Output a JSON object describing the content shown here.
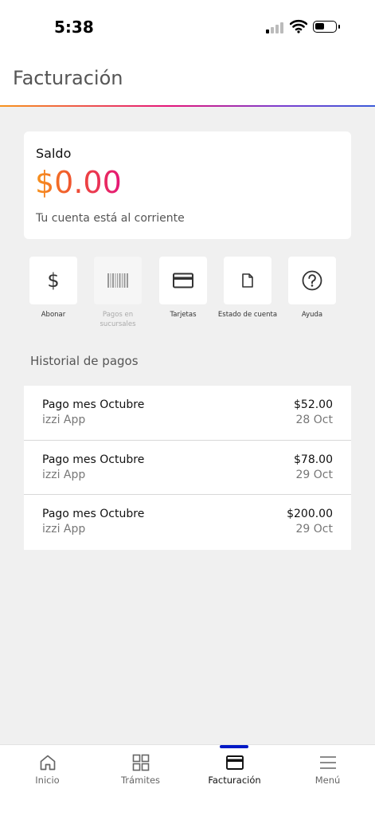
{
  "status_bar": {
    "time": "5:38"
  },
  "header": {
    "title": "Facturación"
  },
  "balance": {
    "label": "Saldo",
    "amount": "$0.00",
    "status": "Tu cuenta está al corriente"
  },
  "actions": [
    {
      "label": "Abonar",
      "icon": "dollar-icon",
      "enabled": true
    },
    {
      "label": "Pagos en sucursales",
      "icon": "barcode-icon",
      "enabled": false
    },
    {
      "label": "Tarjetas",
      "icon": "credit-card-icon",
      "enabled": true
    },
    {
      "label": "Estado de cuenta",
      "icon": "document-icon",
      "enabled": true
    },
    {
      "label": "Ayuda",
      "icon": "help-icon",
      "enabled": true
    }
  ],
  "history": {
    "title": "Historial de pagos",
    "rows": [
      {
        "title": "Pago mes Octubre",
        "source": "izzi App",
        "amount": "$52.00",
        "date": "28 Oct"
      },
      {
        "title": "Pago mes Octubre",
        "source": "izzi App",
        "amount": "$78.00",
        "date": "29 Oct"
      },
      {
        "title": "Pago mes Octubre",
        "source": "izzi App",
        "amount": "$200.00",
        "date": "29 Oct"
      }
    ]
  },
  "tabbar": {
    "active": "Facturación",
    "tabs": [
      {
        "label": "Inicio",
        "icon": "home-icon"
      },
      {
        "label": "Trámites",
        "icon": "grid-icon"
      },
      {
        "label": "Facturación",
        "icon": "credit-card-icon"
      },
      {
        "label": "Menú",
        "icon": "menu-icon"
      }
    ]
  },
  "colors": {
    "accent_orange": "#f7941d",
    "accent_pink": "#e4157a",
    "tab_indicator": "#0019c6",
    "background": "#f0f0f0"
  }
}
